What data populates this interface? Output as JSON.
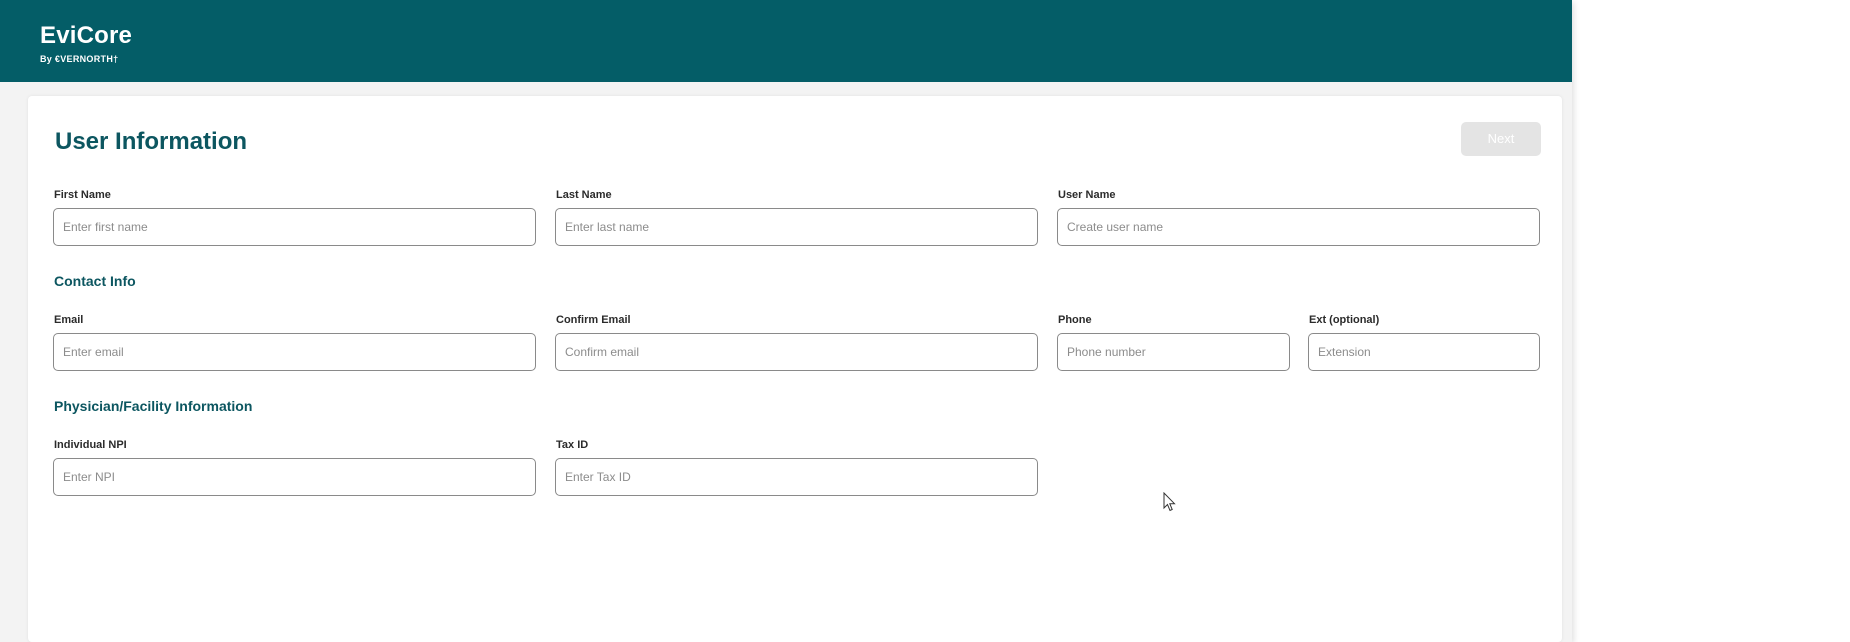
{
  "header": {
    "brand": "EviCore",
    "brand_sub": "By €VERNORTH†",
    "background": "#045d67"
  },
  "page": {
    "title": "User Information",
    "next_label": "Next"
  },
  "fields": {
    "first_name": {
      "label": "First Name",
      "placeholder": "Enter first name"
    },
    "last_name": {
      "label": "Last Name",
      "placeholder": "Enter last name"
    },
    "user_name": {
      "label": "User Name",
      "placeholder": "Create user name"
    },
    "email": {
      "label": "Email",
      "placeholder": "Enter email"
    },
    "confirm_email": {
      "label": "Confirm Email",
      "placeholder": "Confirm email"
    },
    "phone": {
      "label": "Phone",
      "placeholder": "Phone number"
    },
    "ext": {
      "label": "Ext (optional)",
      "placeholder": "Extension"
    },
    "npi": {
      "label": "Individual NPI",
      "placeholder": "Enter NPI"
    },
    "tax_id": {
      "label": "Tax ID",
      "placeholder": "Enter Tax ID"
    }
  },
  "sections": {
    "contact": "Contact Info",
    "physician": "Physician/Facility Information"
  },
  "colors": {
    "accent": "#0c5660",
    "button_disabled": "#e4e4e4"
  },
  "icons": {
    "cursor": "mouse-pointer-icon"
  }
}
